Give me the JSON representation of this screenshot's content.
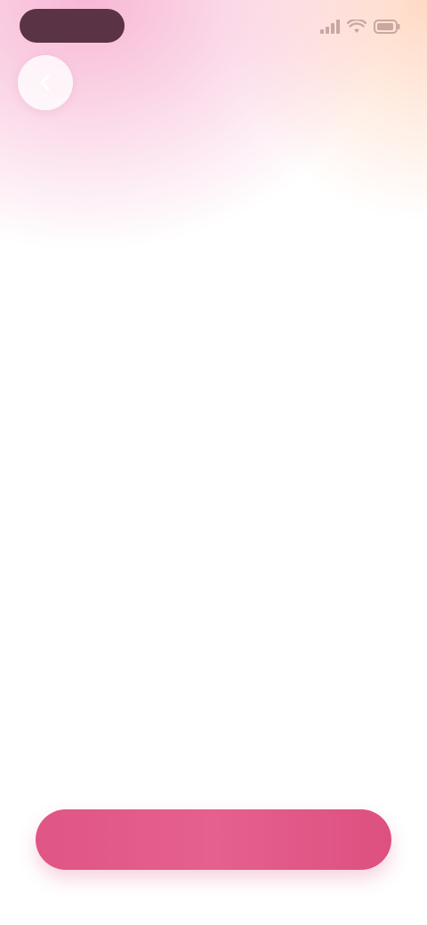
{
  "status_bar": {
    "time": "",
    "signal_icon": "signal-icon",
    "wifi_icon": "wifi-icon",
    "battery_icon": "battery-icon"
  },
  "nav": {
    "back_icon": "chevron-left-icon"
  },
  "main": {
    "headline": "",
    "subtext": ""
  },
  "cta": {
    "label": ""
  },
  "colors": {
    "accent": "#e05585",
    "pill": "#5a3344",
    "headline": "#2c2c34",
    "subtext": "#8a8a95"
  }
}
